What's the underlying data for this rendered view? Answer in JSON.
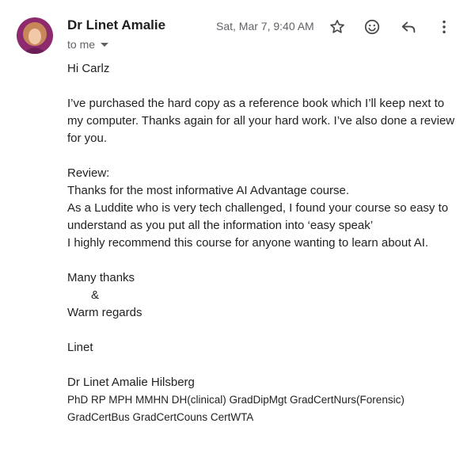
{
  "header": {
    "sender_name": "Dr Linet Amalie",
    "recipient_label": "to me",
    "timestamp": "Sat, Mar 7, 9:40 AM",
    "icons": {
      "star": "star-icon",
      "emoji": "emoji-reaction-icon",
      "reply": "reply-icon",
      "more": "more-vert-icon"
    },
    "avatar_colors": {
      "background": "#8e2a6e",
      "hair": "#c8875a",
      "face": "#f2c9a8"
    }
  },
  "message": {
    "greeting": "Hi Carlz",
    "para1": [
      "I’ve purchased the hard copy as a reference book which I’ll keep next to",
      "my computer. Thanks again for all your hard work. I’ve also done a review",
      "for you."
    ],
    "review_heading": "Review:",
    "review_lines": [
      "Thanks for the most informative AI Advantage course.",
      "As a Luddite who is very tech challenged, I found your course so easy to",
      "understand as you put all the information into ‘easy speak’",
      "I highly recommend this course for anyone wanting to learn about AI."
    ],
    "closing": [
      "Many thanks",
      "&",
      "Warm regards"
    ],
    "signoff": "Linet",
    "signature": {
      "name": "Dr Linet Amalie Hilsberg",
      "credentials_line1": "PhD RP MPH MMHN DH(clinical) GradDipMgt GradCertNurs(Forensic)",
      "credentials_line2": "GradCertBus GradCertCouns CertWTA"
    }
  }
}
